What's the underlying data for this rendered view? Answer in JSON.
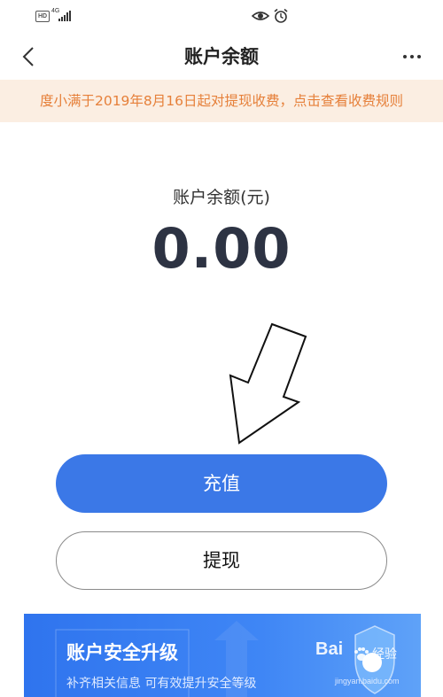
{
  "status_bar": {
    "hd": "HD",
    "network": "4G"
  },
  "nav": {
    "title": "账户余额"
  },
  "notice": {
    "text": "度小满于2019年8月16日起对提现收费，点击查看收费规则"
  },
  "balance": {
    "label": "账户余额(元)",
    "value": "0.00"
  },
  "actions": {
    "recharge": "充值",
    "withdraw": "提现"
  },
  "banner": {
    "title": "账户安全升级",
    "subtitle": "补齐相关信息 可有效提升安全等级"
  },
  "watermark": {
    "logo": "Bai",
    "text": "经验",
    "url": "jingyan.baidu.com"
  },
  "colors": {
    "primary": "#3b78e7",
    "notice_bg": "#fbeee2",
    "notice_text": "#e6803a",
    "balance_text": "#2d3343"
  }
}
